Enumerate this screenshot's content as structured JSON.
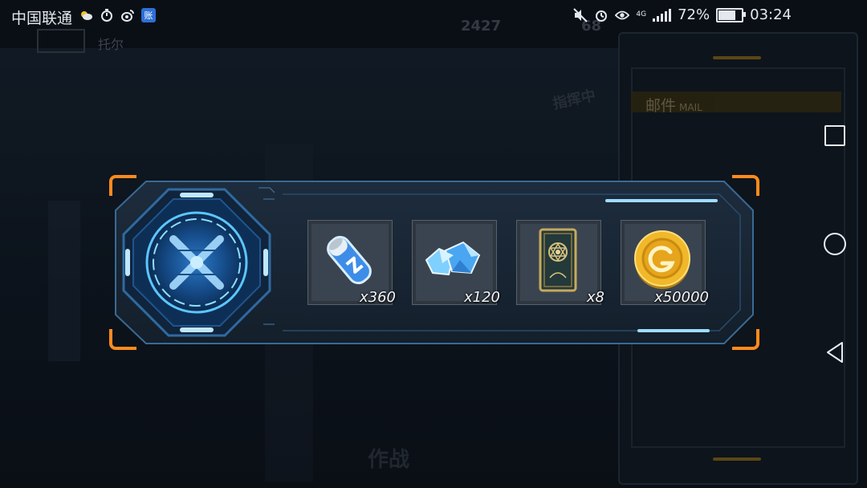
{
  "status_bar": {
    "carrier": "中国联通",
    "app_badge": "账",
    "battery": "72%",
    "time": "03:24",
    "network": "4G"
  },
  "background": {
    "player_name": "托尔",
    "resource_1": "2427",
    "resource_2": "68",
    "command_text": "指挥中",
    "battle_label": "作战",
    "mail_title": "邮件",
    "mail_subtitle": "MAIL"
  },
  "reward": {
    "items": [
      {
        "name": "energy-canister",
        "qty": "x360"
      },
      {
        "name": "crystal-shards",
        "qty": "x120"
      },
      {
        "name": "tarot-card",
        "qty": "x8"
      },
      {
        "name": "gold-coin",
        "qty": "x50000"
      }
    ]
  },
  "colors": {
    "accent_orange": "#ff8a1e",
    "panel_blue": "#1a3a5c",
    "glow_cyan": "#6fd3ff"
  }
}
